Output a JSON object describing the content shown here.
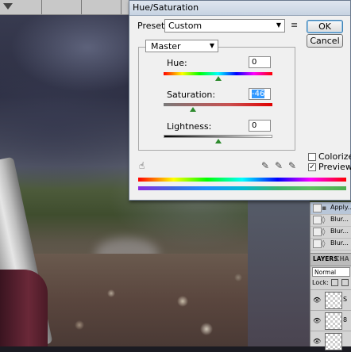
{
  "dialog": {
    "title": "Hue/Saturation",
    "preset_label": "Preset:",
    "preset_value": "Custom",
    "ok_label": "OK",
    "cancel_label": "Cancel",
    "channel_value": "Master",
    "hue_label": "Hue:",
    "hue_value": "0",
    "saturation_label": "Saturation:",
    "saturation_value": "-46",
    "lightness_label": "Lightness:",
    "lightness_value": "0",
    "colorize_label": "Colorize",
    "colorize_checked": false,
    "preview_label": "Preview",
    "preview_checked": true,
    "slider_fractions": {
      "hue": 0.5,
      "saturation": 0.27,
      "lightness": 0.5
    }
  },
  "history": {
    "items": [
      {
        "label": "Apply..."
      },
      {
        "label": "Blur..."
      },
      {
        "label": "Blur..."
      },
      {
        "label": "Blur..."
      }
    ]
  },
  "layers_panel": {
    "tab_layers": "LAYERS",
    "tab_channels": "CHA",
    "blend_mode": "Normal",
    "lock_label": "Lock:",
    "layers": [
      {
        "label": "S"
      },
      {
        "label": "8"
      },
      {
        "label": ""
      }
    ]
  },
  "icons": {
    "menu": "list-menu-icon",
    "eyedroppers": [
      "eyedropper-icon",
      "eyedropper-plus-icon",
      "eyedropper-minus-icon"
    ],
    "target": "on-image-adjust-icon"
  },
  "colors": {
    "slider_thumb": "#2d8a2d",
    "selection": "#3399ff"
  }
}
